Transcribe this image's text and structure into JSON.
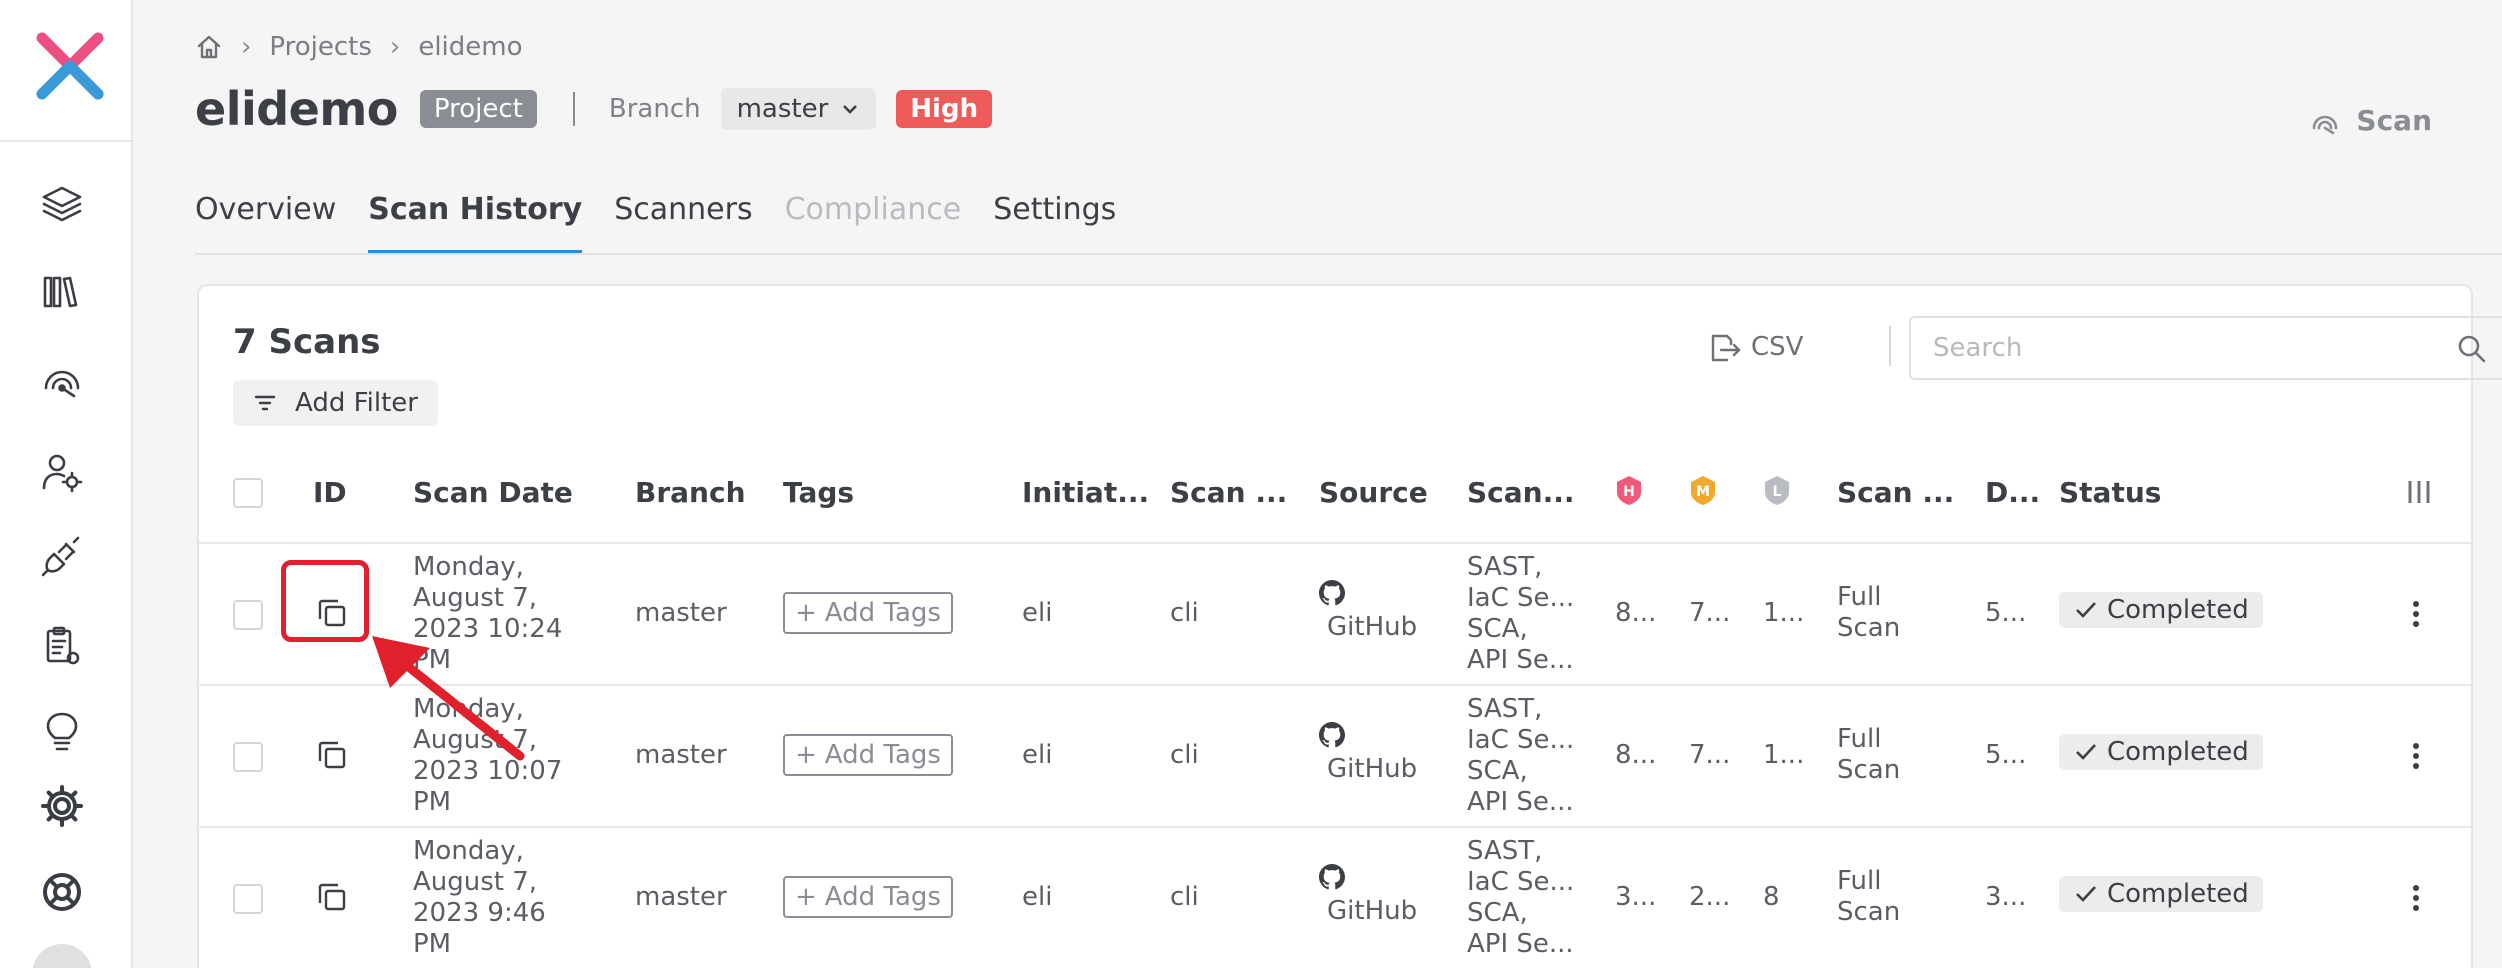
{
  "colors": {
    "accent": "#2d8ad3",
    "high": "#ef5a5a",
    "medium": "#f0a92c",
    "low": "#b9bcc2",
    "annotation": "#e0202a"
  },
  "sidebar": {
    "icons": [
      "layers-icon",
      "library-icon",
      "scan-radar-icon",
      "user-settings-icon",
      "plug-icon",
      "report-icon",
      "lightbulb-icon",
      "gear-icon",
      "help-icon"
    ]
  },
  "breadcrumb": {
    "items": [
      "Projects",
      "elidemo"
    ]
  },
  "header": {
    "title": "elidemo",
    "type_badge": "Project",
    "branch_label": "Branch",
    "branch_value": "master",
    "severity_badge": "High",
    "scan_button": "Scan"
  },
  "tabs": [
    {
      "label": "Overview",
      "state": "normal"
    },
    {
      "label": "Scan History",
      "state": "active"
    },
    {
      "label": "Scanners",
      "state": "normal"
    },
    {
      "label": "Compliance",
      "state": "disabled"
    },
    {
      "label": "Settings",
      "state": "normal"
    }
  ],
  "card": {
    "count_label": "7 Scans",
    "add_filter": "Add Filter",
    "csv_label": "CSV",
    "search_placeholder": "Search"
  },
  "table": {
    "headers": {
      "id": "ID",
      "scan_date": "Scan Date",
      "branch": "Branch",
      "tags": "Tags",
      "initiator": "Initiat...",
      "scan_origin": "Scan ...",
      "source": "Source",
      "scanners": "Scan...",
      "high": "H",
      "medium": "M",
      "low": "L",
      "scan_type": "Scan ...",
      "duration": "D...",
      "status": "Status"
    },
    "rows": [
      {
        "date_lines": [
          "Monday,",
          "August 7,",
          "2023 10:24",
          "PM"
        ],
        "branch": "master",
        "tags": "Add Tags",
        "initiator": "eli",
        "origin": "cli",
        "source": "GitHub",
        "scanners": [
          "SAST,",
          "IaC Se...",
          "SCA,",
          "API Se..."
        ],
        "high": "8...",
        "medium": "7...",
        "low": "1...",
        "type_lines": [
          "Full",
          "Scan"
        ],
        "duration": "5...",
        "status": "Completed"
      },
      {
        "date_lines": [
          "Monday,",
          "August 7,",
          "2023 10:07",
          "PM"
        ],
        "branch": "master",
        "tags": "Add Tags",
        "initiator": "eli",
        "origin": "cli",
        "source": "GitHub",
        "scanners": [
          "SAST,",
          "IaC Se...",
          "SCA,",
          "API Se..."
        ],
        "high": "8...",
        "medium": "7...",
        "low": "1...",
        "type_lines": [
          "Full",
          "Scan"
        ],
        "duration": "5...",
        "status": "Completed"
      },
      {
        "date_lines": [
          "Monday,",
          "August 7,",
          "2023 9:46",
          "PM"
        ],
        "branch": "master",
        "tags": "Add Tags",
        "initiator": "eli",
        "origin": "cli",
        "source": "GitHub",
        "scanners": [
          "SAST,",
          "IaC Se...",
          "SCA,",
          "API Se..."
        ],
        "high": "3...",
        "medium": "2...",
        "low": "8",
        "type_lines": [
          "Full",
          "Scan"
        ],
        "duration": "3...",
        "status": "Completed"
      }
    ]
  }
}
